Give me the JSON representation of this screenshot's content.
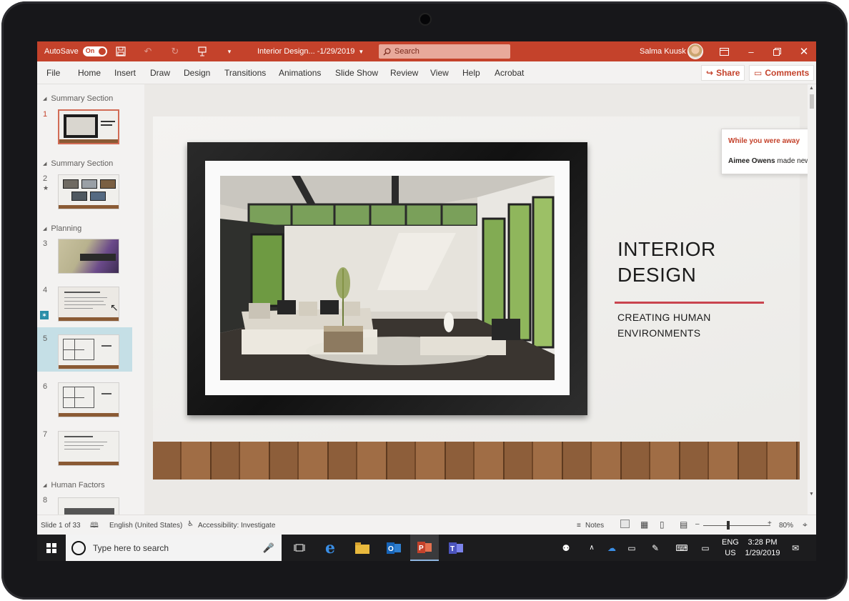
{
  "titlebar": {
    "autosave_label": "AutoSave",
    "autosave_state": "On",
    "doc_title": "Interior Design... -1/29/2019",
    "search_placeholder": "Search",
    "user_name": "Salma Kuusk"
  },
  "menu": {
    "items": [
      "File",
      "Home",
      "Insert",
      "Draw",
      "Design",
      "Transitions",
      "Animations",
      "Slide Show",
      "Review",
      "View",
      "Help",
      "Acrobat"
    ],
    "share_label": "Share",
    "comments_label": "Comments"
  },
  "thumbnails": {
    "sections": [
      "Summary Section",
      "Summary Section",
      "Planning",
      "Human Factors"
    ],
    "slide_numbers": [
      "1",
      "2",
      "3",
      "4",
      "5",
      "6",
      "7",
      "8"
    ]
  },
  "slide": {
    "title_line1": "INTERIOR",
    "title_line2": "DESIGN",
    "subtitle_line1": "CREATING HUMAN",
    "subtitle_line2": "ENVIRONMENTS"
  },
  "notification": {
    "heading": "While you were away",
    "author": "Aimee Owens",
    "message": "made new changes."
  },
  "statusbar": {
    "slide_count": "Slide 1 of 33",
    "language": "English (United States)",
    "accessibility": "Accessibility: Investigate",
    "notes_label": "Notes",
    "zoom": "80%"
  },
  "taskbar": {
    "search_placeholder": "Type here to search",
    "lang_line1": "ENG",
    "lang_line2": "US",
    "time": "3:28 PM",
    "date": "1/29/2019"
  },
  "colors": {
    "accent": "#c4422b",
    "slide_rule": "#c9444f",
    "selection": "#c5dfe6"
  }
}
